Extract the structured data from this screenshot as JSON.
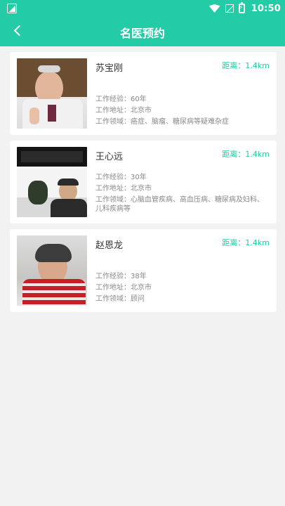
{
  "status_bar": {
    "time": "10:50",
    "icons": [
      "notification-icon",
      "wifi-icon",
      "signal-off-icon",
      "battery-charging-icon"
    ]
  },
  "header": {
    "title": "名医预约",
    "back_icon": "chevron-left-icon"
  },
  "colors": {
    "accent": "#23cba6",
    "distance_text": "#22c7a3",
    "card_bg": "#ffffff",
    "page_bg": "#f2f2f2"
  },
  "doctors": [
    {
      "name": "苏宝刚",
      "distance": "距离：1.4km",
      "experience": "工作经验：60年",
      "address": "工作地址：北京市",
      "field": "工作领域：癌症、脑瘤、糖尿病等疑难杂症"
    },
    {
      "name": "王心远",
      "distance": "距离：1.4km",
      "experience": "工作经验：30年",
      "address": "工作地址：北京市",
      "field": "工作领域：心脑血管疾病、高血压病、糖尿病及妇科、儿科疾病等"
    },
    {
      "name": "赵恩龙",
      "distance": "距离：1.4km",
      "experience": "工作经验：38年",
      "address": "工作地址：北京市",
      "field": "工作领域：顾问"
    }
  ]
}
